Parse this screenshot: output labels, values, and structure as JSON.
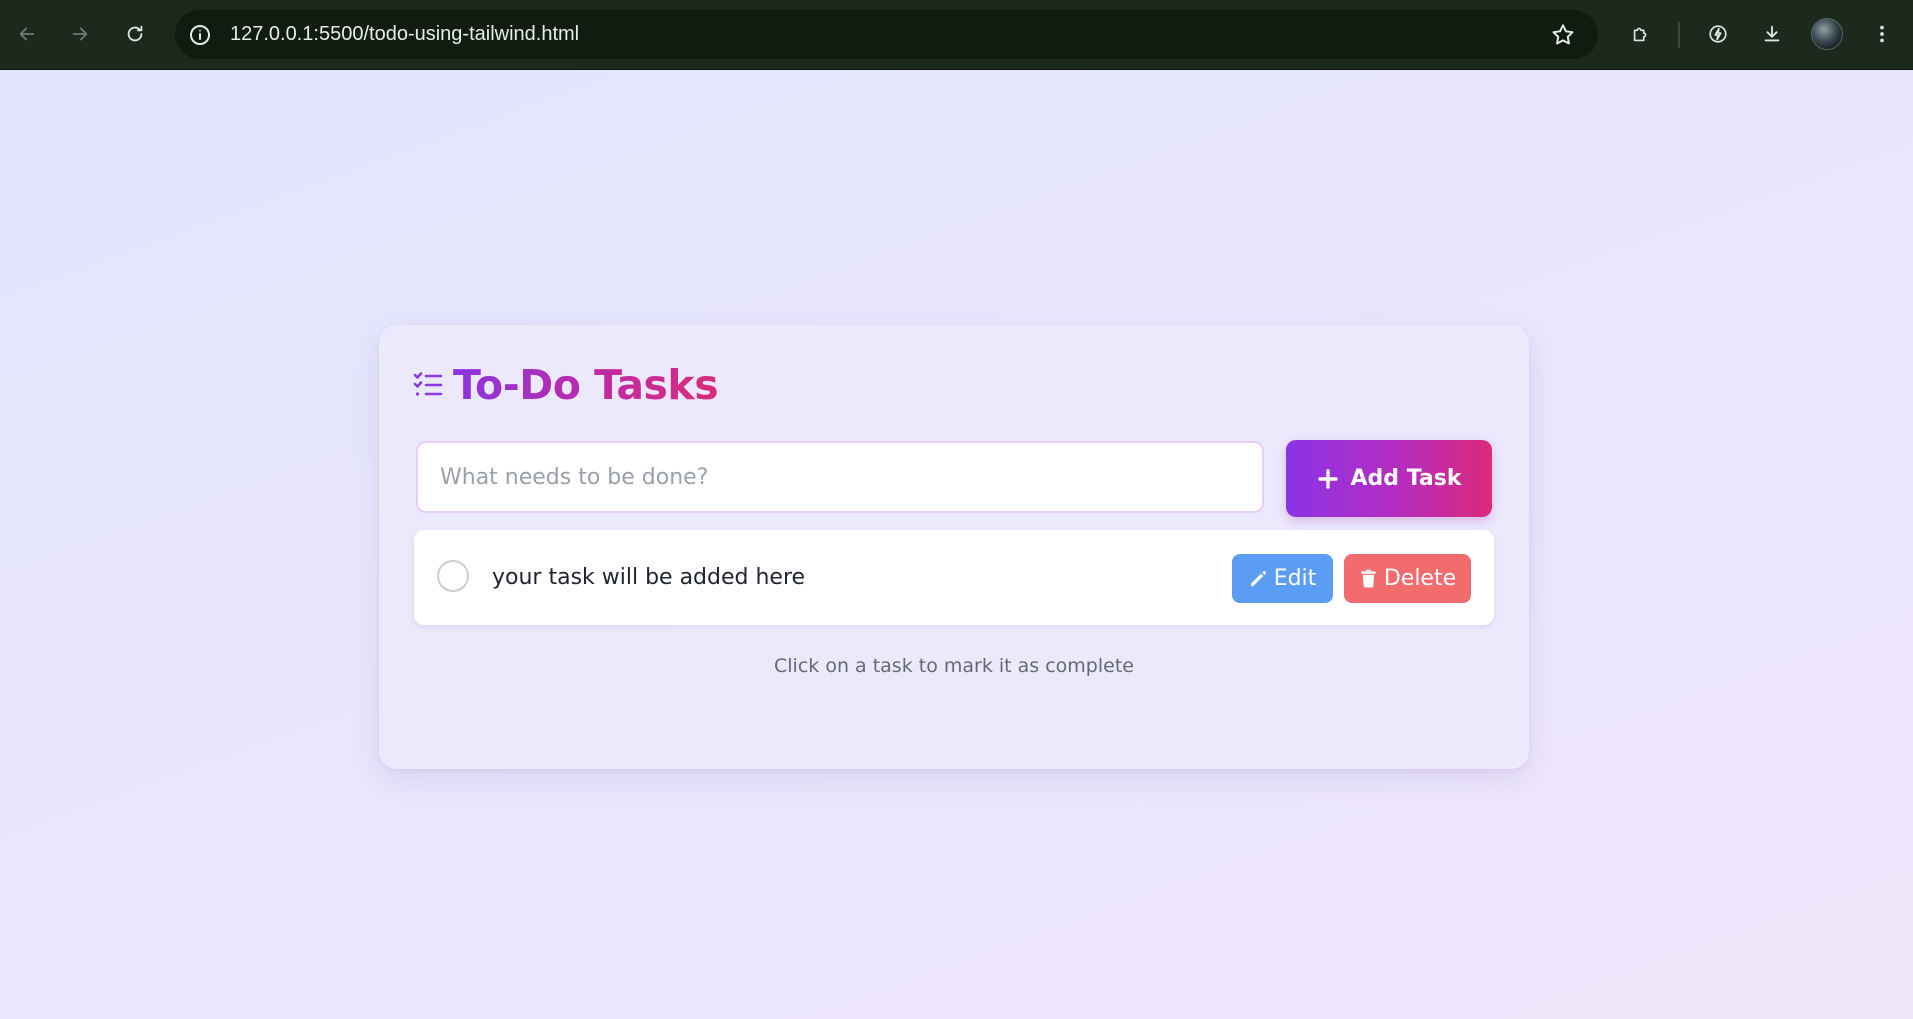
{
  "browser": {
    "url": "127.0.0.1:5500/todo-using-tailwind.html",
    "icons": {
      "back": "arrow-left-icon",
      "forward": "arrow-right-icon",
      "reload": "reload-icon",
      "site_info": "info-icon",
      "bookmark": "star-icon",
      "extensions": "puzzle-icon",
      "performance": "leaf-bolt-icon",
      "downloads": "download-icon",
      "profile": "avatar",
      "menu": "kebab-menu-icon"
    }
  },
  "app": {
    "title": "To-Do Tasks",
    "title_icon": "list-check-icon",
    "input": {
      "placeholder": "What needs to be done?",
      "value": ""
    },
    "add_button": {
      "label": "Add Task",
      "icon": "plus-icon"
    },
    "tasks": [
      {
        "text": "your task will be added here",
        "completed": false,
        "edit_label": "Edit",
        "delete_label": "Delete"
      }
    ],
    "hint": "Click on a task to mark it as complete"
  },
  "colors": {
    "accent_purple": "#8a34e6",
    "accent_pink": "#db2a78",
    "edit_blue": "#5b9cf5",
    "delete_red": "#f26b6d",
    "chrome_bg": "#1b2a1d"
  }
}
